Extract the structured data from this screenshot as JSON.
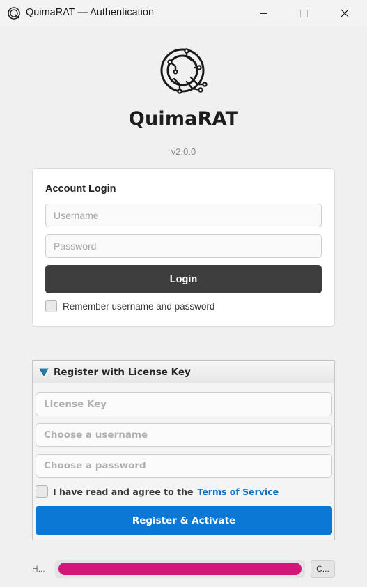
{
  "window": {
    "title": "QuimaRAT — Authentication",
    "icon": "quimarat-logo-icon",
    "controls": [
      "minimize-icon",
      "maximize-icon",
      "close-icon"
    ]
  },
  "brand": {
    "name": "QuimaRAT",
    "version": "v2.0.0",
    "logo": "quimarat-logo-icon"
  },
  "login": {
    "title": "Account Login",
    "username_placeholder": "Username",
    "username_value": "",
    "password_placeholder": "Password",
    "password_value": "",
    "button_label": "Login",
    "remember_label": "Remember username and password",
    "remember_checked": false
  },
  "register": {
    "header": "Register with License Key",
    "expanded": true,
    "license_placeholder": "License Key",
    "license_value": "",
    "username_placeholder": "Choose a username",
    "username_value": "",
    "password_placeholder": "Choose a password",
    "password_value": "",
    "agree_label": "I have read and agree to the",
    "tos_link": "Terms of Service",
    "agree_checked": false,
    "button_label": "Register & Activate"
  },
  "status": {
    "text": "H...",
    "progress": 1.0,
    "button_label": "C..."
  },
  "colors": {
    "accent": "#0a78d4",
    "login_button": "#3e3e3e",
    "progress_fill": "#d4157a",
    "link": "#0b6fc6"
  }
}
